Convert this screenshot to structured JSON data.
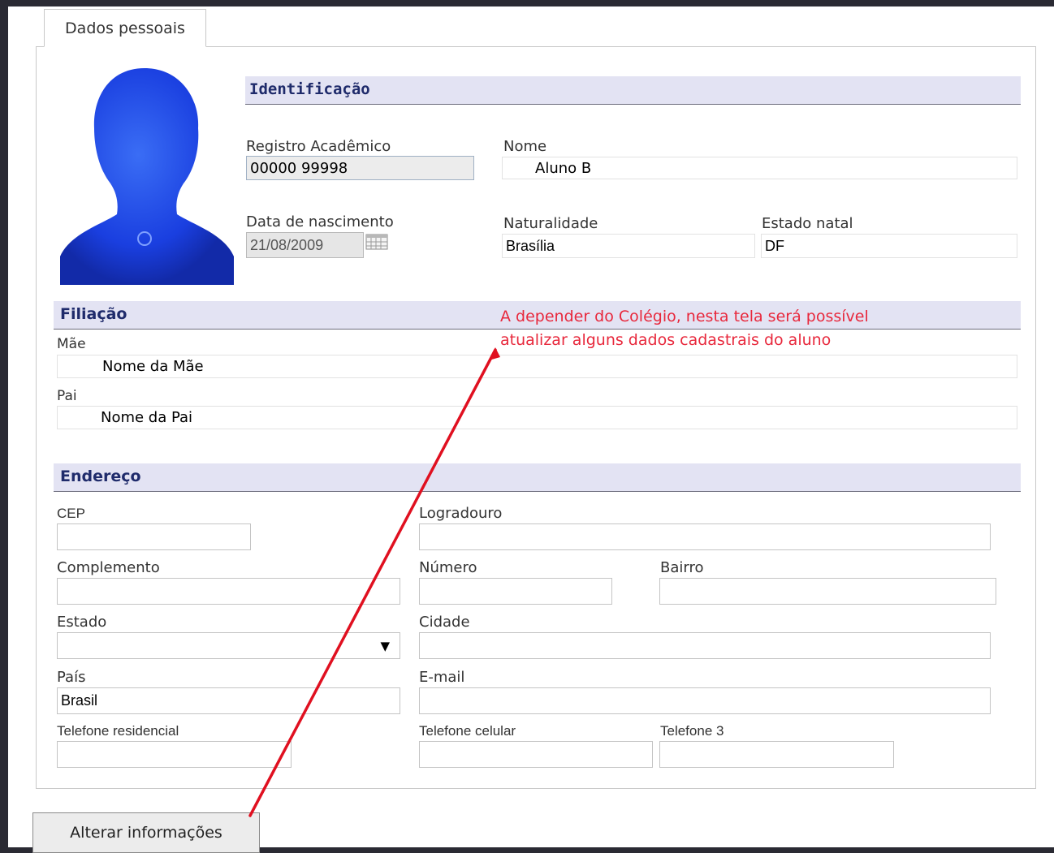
{
  "tab": {
    "label": "Dados pessoais"
  },
  "identificacao": {
    "title": "Identificação",
    "ra_label": "Registro Acadêmico",
    "ra_value": "00000 99998",
    "nome_label": "Nome",
    "nome_value": "Aluno B",
    "nasc_label": "Data de nascimento",
    "nasc_value": "21/08/2009",
    "natural_label": "Naturalidade",
    "natural_value": "Brasília",
    "estado_natal_label": "Estado natal",
    "estado_natal_value": "DF"
  },
  "filiacao": {
    "title": "Filiação",
    "mae_label": "Mãe",
    "mae_value": "Nome da Mãe",
    "pai_label": "Pai",
    "pai_value": "Nome da Pai"
  },
  "endereco": {
    "title": "Endereço",
    "cep_label": "CEP",
    "logradouro_label": "Logradouro",
    "complemento_label": "Complemento",
    "numero_label": "Número",
    "bairro_label": "Bairro",
    "estado_label": "Estado",
    "estado_value": "",
    "cidade_label": "Cidade",
    "pais_label": "País",
    "pais_value": "Brasil",
    "email_label": "E-mail",
    "tel_res_label": "Telefone residencial",
    "tel_cel_label": "Telefone celular",
    "tel3_label": "Telefone 3"
  },
  "annotation": {
    "line1": "A depender do Colégio, nesta tela será possível",
    "line2": "atualizar alguns dados cadastrais do aluno",
    "color": "#e8283c"
  },
  "actions": {
    "alterar_label": "Alterar informações"
  },
  "icons": {
    "avatar": "user-silhouette-icon",
    "calendar": "calendar-icon",
    "dropdown": "chevron-down-icon"
  }
}
